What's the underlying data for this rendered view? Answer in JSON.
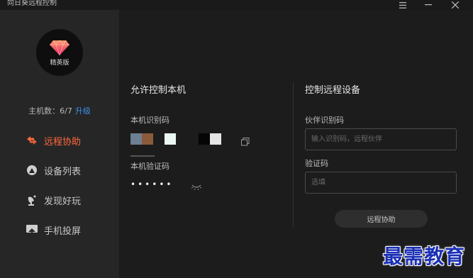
{
  "window": {
    "title": "向日葵远程控制",
    "controls": [
      "menu-icon",
      "minimize-icon",
      "close-icon"
    ]
  },
  "sidebar": {
    "edition_label": "精英版",
    "host_count_label": "主机数：6/7",
    "upgrade_label": "升级",
    "items": [
      {
        "label": "远程协助",
        "icon": "remote-assist-icon",
        "active": true
      },
      {
        "label": "设备列表",
        "icon": "device-list-icon",
        "active": false
      },
      {
        "label": "发现好玩",
        "icon": "discover-icon",
        "active": false
      },
      {
        "label": "手机投屏",
        "icon": "screen-cast-icon",
        "active": false
      }
    ]
  },
  "allow_control": {
    "title": "允许控制本机",
    "id_label": "本机识别码",
    "password_label": "本机验证码",
    "password_value": "••••••"
  },
  "remote_control": {
    "title": "控制远程设备",
    "partner_id_label": "伙伴识别码",
    "partner_id_placeholder": "输入识别码，远程伙伴",
    "verify_label": "验证码",
    "verify_placeholder": "选填",
    "connect_button": "远程协助"
  },
  "watermark": "最需教育",
  "colors": {
    "accent": "#ff6a3d",
    "link": "#3f8ee8",
    "sidebar_bg": "#262626",
    "main_bg": "#1c1c1c"
  }
}
